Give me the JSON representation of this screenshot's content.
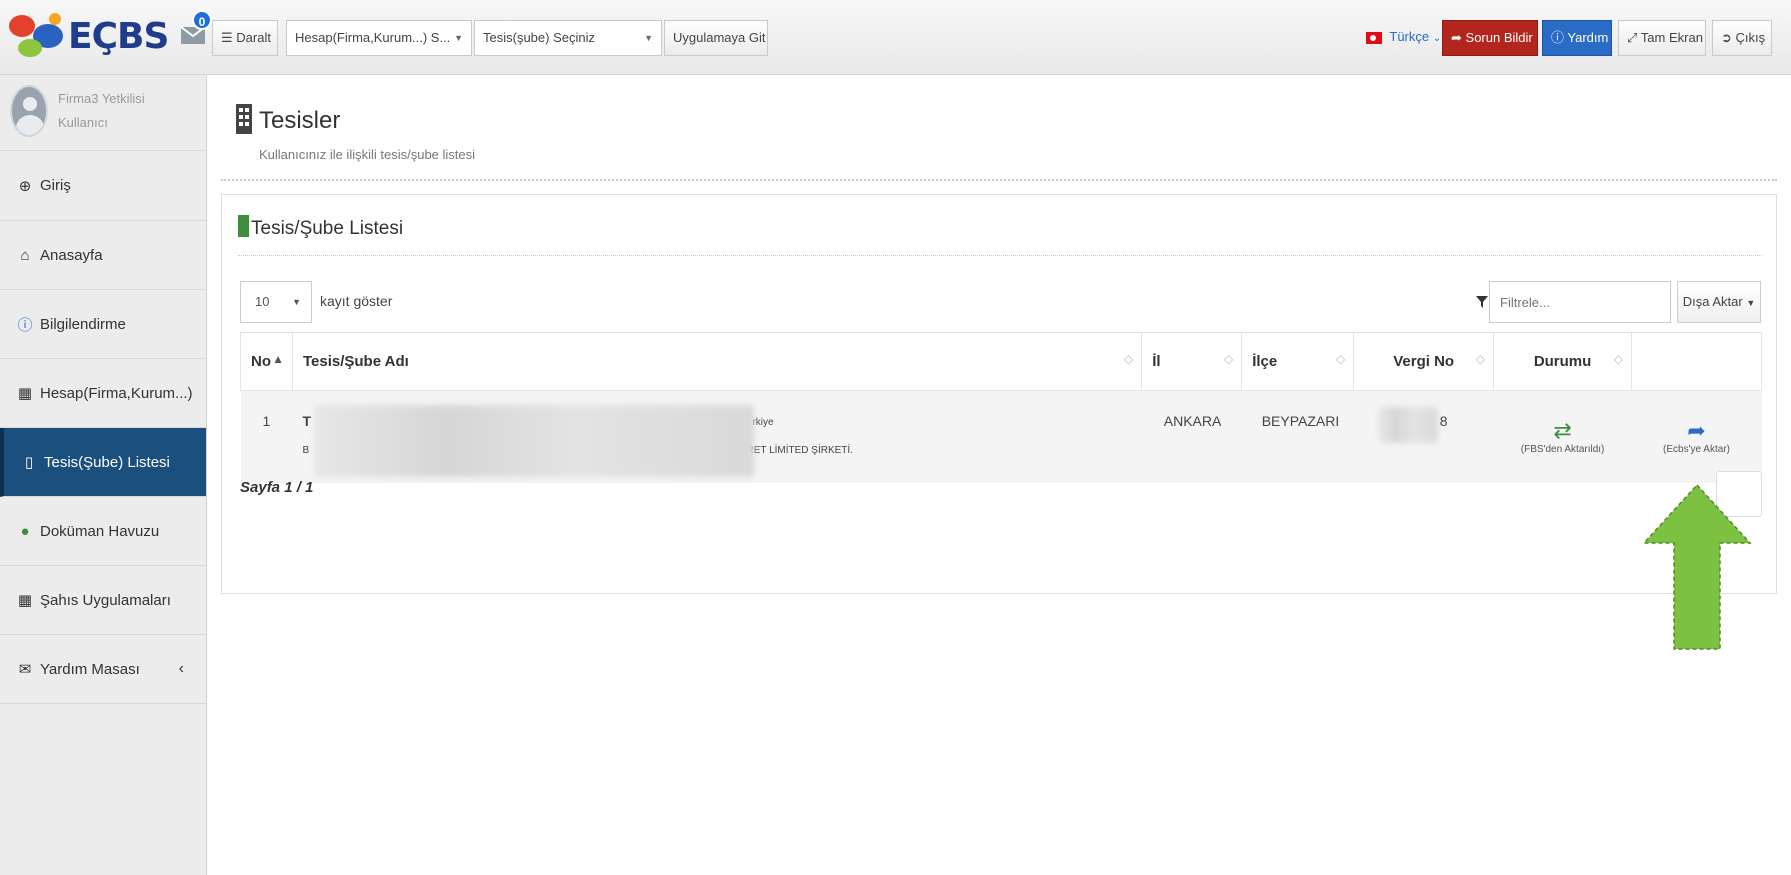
{
  "app": {
    "logo_text": "EÇBS",
    "notification_count": "0"
  },
  "topbar": {
    "collapse_label": "Daralt",
    "account_select": "Hesap(Firma,Kurum...) S...",
    "facility_select": "Tesis(şube) Seçiniz",
    "go_app_label": "Uygulamaya Git",
    "language_label": "Türkçe",
    "report_label": "Sorun Bildir",
    "help_label": "Yardım",
    "fullscreen_label": "Tam Ekran",
    "exit_label": "Çıkış"
  },
  "user": {
    "name_line1": "Firma3 Yetkilisi",
    "name_line2": "Kullanıcı"
  },
  "sidebar": {
    "items": [
      {
        "label": "Giriş"
      },
      {
        "label": "Anasayfa"
      },
      {
        "label": "Bilgilendirme"
      },
      {
        "label": "Hesap(Firma,Kurum...)"
      },
      {
        "label": "Tesis(Şube) Listesi"
      },
      {
        "label": "Doküman Havuzu"
      },
      {
        "label": "Şahıs Uygulamaları"
      },
      {
        "label": "Yardım Masası"
      }
    ]
  },
  "page": {
    "title": "Tesisler",
    "subtitle": "Kullanıcınız ile ilişkili tesis/şube listesi"
  },
  "panel": {
    "title": "Tesis/Şube Listesi",
    "page_length": "10",
    "page_length_label": "kayıt göster",
    "filter_placeholder": "Filtrele...",
    "export_label": "Dışa Aktar",
    "pager": "Sayfa 1 / 1"
  },
  "table": {
    "headers": [
      "No",
      "Tesis/Şube Adı",
      "İl",
      "İlçe",
      "Vergi No",
      "Durumu",
      ""
    ],
    "row": {
      "no": "1",
      "name_start": "T",
      "name_end": "rkiye",
      "address_start": "B",
      "address_end": "RET LİMİTED ŞİRKETİ.",
      "city": "ANKARA",
      "district": "BEYPAZARI",
      "tax_no_end": "8",
      "status_note": "(FBS'den Aktarıldı)",
      "action_note": "(Ecbs'ye Aktar)"
    }
  },
  "colors": {
    "sidebar_active": "#1b4f7e",
    "report_btn": "#b3261e",
    "help_btn": "#2a6cc5",
    "arrow": "#7dc142"
  }
}
